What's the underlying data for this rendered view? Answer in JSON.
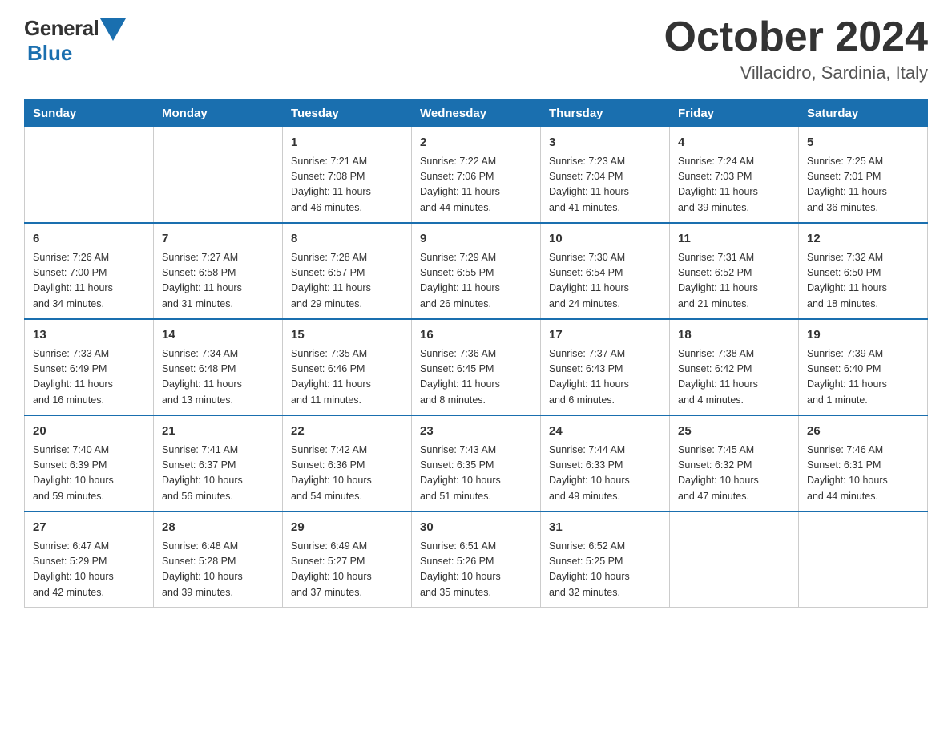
{
  "header": {
    "logo_general": "General",
    "logo_blue": "Blue",
    "month_year": "October 2024",
    "location": "Villacidro, Sardinia, Italy"
  },
  "days_of_week": [
    "Sunday",
    "Monday",
    "Tuesday",
    "Wednesday",
    "Thursday",
    "Friday",
    "Saturday"
  ],
  "weeks": [
    [
      {
        "day": "",
        "info": ""
      },
      {
        "day": "",
        "info": ""
      },
      {
        "day": "1",
        "info": "Sunrise: 7:21 AM\nSunset: 7:08 PM\nDaylight: 11 hours\nand 46 minutes."
      },
      {
        "day": "2",
        "info": "Sunrise: 7:22 AM\nSunset: 7:06 PM\nDaylight: 11 hours\nand 44 minutes."
      },
      {
        "day": "3",
        "info": "Sunrise: 7:23 AM\nSunset: 7:04 PM\nDaylight: 11 hours\nand 41 minutes."
      },
      {
        "day": "4",
        "info": "Sunrise: 7:24 AM\nSunset: 7:03 PM\nDaylight: 11 hours\nand 39 minutes."
      },
      {
        "day": "5",
        "info": "Sunrise: 7:25 AM\nSunset: 7:01 PM\nDaylight: 11 hours\nand 36 minutes."
      }
    ],
    [
      {
        "day": "6",
        "info": "Sunrise: 7:26 AM\nSunset: 7:00 PM\nDaylight: 11 hours\nand 34 minutes."
      },
      {
        "day": "7",
        "info": "Sunrise: 7:27 AM\nSunset: 6:58 PM\nDaylight: 11 hours\nand 31 minutes."
      },
      {
        "day": "8",
        "info": "Sunrise: 7:28 AM\nSunset: 6:57 PM\nDaylight: 11 hours\nand 29 minutes."
      },
      {
        "day": "9",
        "info": "Sunrise: 7:29 AM\nSunset: 6:55 PM\nDaylight: 11 hours\nand 26 minutes."
      },
      {
        "day": "10",
        "info": "Sunrise: 7:30 AM\nSunset: 6:54 PM\nDaylight: 11 hours\nand 24 minutes."
      },
      {
        "day": "11",
        "info": "Sunrise: 7:31 AM\nSunset: 6:52 PM\nDaylight: 11 hours\nand 21 minutes."
      },
      {
        "day": "12",
        "info": "Sunrise: 7:32 AM\nSunset: 6:50 PM\nDaylight: 11 hours\nand 18 minutes."
      }
    ],
    [
      {
        "day": "13",
        "info": "Sunrise: 7:33 AM\nSunset: 6:49 PM\nDaylight: 11 hours\nand 16 minutes."
      },
      {
        "day": "14",
        "info": "Sunrise: 7:34 AM\nSunset: 6:48 PM\nDaylight: 11 hours\nand 13 minutes."
      },
      {
        "day": "15",
        "info": "Sunrise: 7:35 AM\nSunset: 6:46 PM\nDaylight: 11 hours\nand 11 minutes."
      },
      {
        "day": "16",
        "info": "Sunrise: 7:36 AM\nSunset: 6:45 PM\nDaylight: 11 hours\nand 8 minutes."
      },
      {
        "day": "17",
        "info": "Sunrise: 7:37 AM\nSunset: 6:43 PM\nDaylight: 11 hours\nand 6 minutes."
      },
      {
        "day": "18",
        "info": "Sunrise: 7:38 AM\nSunset: 6:42 PM\nDaylight: 11 hours\nand 4 minutes."
      },
      {
        "day": "19",
        "info": "Sunrise: 7:39 AM\nSunset: 6:40 PM\nDaylight: 11 hours\nand 1 minute."
      }
    ],
    [
      {
        "day": "20",
        "info": "Sunrise: 7:40 AM\nSunset: 6:39 PM\nDaylight: 10 hours\nand 59 minutes."
      },
      {
        "day": "21",
        "info": "Sunrise: 7:41 AM\nSunset: 6:37 PM\nDaylight: 10 hours\nand 56 minutes."
      },
      {
        "day": "22",
        "info": "Sunrise: 7:42 AM\nSunset: 6:36 PM\nDaylight: 10 hours\nand 54 minutes."
      },
      {
        "day": "23",
        "info": "Sunrise: 7:43 AM\nSunset: 6:35 PM\nDaylight: 10 hours\nand 51 minutes."
      },
      {
        "day": "24",
        "info": "Sunrise: 7:44 AM\nSunset: 6:33 PM\nDaylight: 10 hours\nand 49 minutes."
      },
      {
        "day": "25",
        "info": "Sunrise: 7:45 AM\nSunset: 6:32 PM\nDaylight: 10 hours\nand 47 minutes."
      },
      {
        "day": "26",
        "info": "Sunrise: 7:46 AM\nSunset: 6:31 PM\nDaylight: 10 hours\nand 44 minutes."
      }
    ],
    [
      {
        "day": "27",
        "info": "Sunrise: 6:47 AM\nSunset: 5:29 PM\nDaylight: 10 hours\nand 42 minutes."
      },
      {
        "day": "28",
        "info": "Sunrise: 6:48 AM\nSunset: 5:28 PM\nDaylight: 10 hours\nand 39 minutes."
      },
      {
        "day": "29",
        "info": "Sunrise: 6:49 AM\nSunset: 5:27 PM\nDaylight: 10 hours\nand 37 minutes."
      },
      {
        "day": "30",
        "info": "Sunrise: 6:51 AM\nSunset: 5:26 PM\nDaylight: 10 hours\nand 35 minutes."
      },
      {
        "day": "31",
        "info": "Sunrise: 6:52 AM\nSunset: 5:25 PM\nDaylight: 10 hours\nand 32 minutes."
      },
      {
        "day": "",
        "info": ""
      },
      {
        "day": "",
        "info": ""
      }
    ]
  ]
}
